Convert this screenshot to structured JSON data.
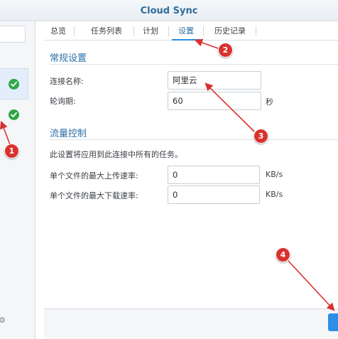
{
  "window": {
    "title": "Cloud Sync"
  },
  "tabs": [
    {
      "label": "总览"
    },
    {
      "label": "任务列表"
    },
    {
      "label": "计划"
    },
    {
      "label": "设置",
      "active": true
    },
    {
      "label": "历史记录"
    }
  ],
  "general": {
    "heading": "常规设置",
    "connection_name_label": "连接名称:",
    "connection_name_value": "阿里云",
    "poll_label": "轮询期:",
    "poll_value": "60",
    "poll_unit": "秒"
  },
  "traffic": {
    "heading": "流量控制",
    "description": "此设置将应用到此连接中所有的任务。",
    "upload_label": "单个文件的最大上传速率:",
    "upload_value": "0",
    "upload_unit": "KB/s",
    "download_label": "单个文件的最大下载速率:",
    "download_value": "0",
    "download_unit": "KB/s"
  },
  "sidebar": {
    "items": [
      {
        "status": "check"
      },
      {
        "status": "check"
      }
    ]
  },
  "annotations": [
    {
      "number": "1"
    },
    {
      "number": "2"
    },
    {
      "number": "3"
    },
    {
      "number": "4"
    }
  ],
  "colors": {
    "accent": "#2b8fe0",
    "heading": "#2b6fa6",
    "success": "#30a64a",
    "marker": "#d9322e"
  },
  "icons": {
    "status": "check-circle-icon",
    "settings": "gear-icon"
  }
}
